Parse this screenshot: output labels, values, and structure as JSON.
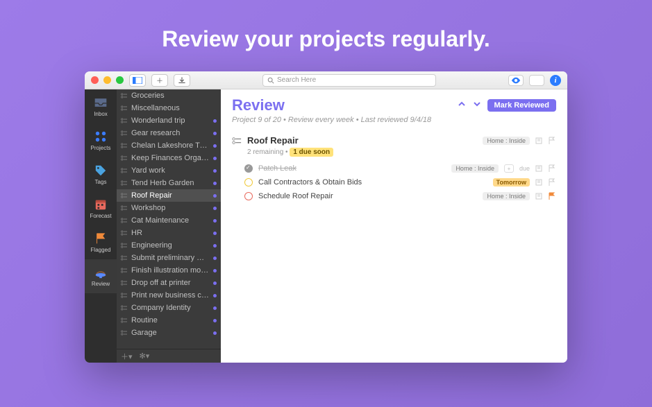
{
  "headline": "Review your projects regularly.",
  "search": {
    "placeholder": "Search Here"
  },
  "rail": {
    "items": [
      {
        "id": "inbox",
        "label": "Inbox"
      },
      {
        "id": "projects",
        "label": "Projects"
      },
      {
        "id": "tags",
        "label": "Tags"
      },
      {
        "id": "forecast",
        "label": "Forecast"
      },
      {
        "id": "flagged",
        "label": "Flagged"
      },
      {
        "id": "review",
        "label": "Review"
      }
    ]
  },
  "projects": [
    {
      "name": "Groceries",
      "dot": false
    },
    {
      "name": "Miscellaneous",
      "dot": false
    },
    {
      "name": "Wonderland trip",
      "dot": true
    },
    {
      "name": "Gear research",
      "dot": true
    },
    {
      "name": "Chelan Lakeshore Trail",
      "dot": true
    },
    {
      "name": "Keep Finances Organized",
      "dot": true
    },
    {
      "name": "Yard work",
      "dot": true
    },
    {
      "name": "Tend Herb Garden",
      "dot": true
    },
    {
      "name": "Roof Repair",
      "dot": true,
      "selected": true
    },
    {
      "name": "Workshop",
      "dot": true
    },
    {
      "name": "Cat Maintenance",
      "dot": true
    },
    {
      "name": "HR",
      "dot": true
    },
    {
      "name": "Engineering",
      "dot": true
    },
    {
      "name": "Submit preliminary marketin…",
      "dot": true
    },
    {
      "name": "Finish illustration mockups",
      "dot": true
    },
    {
      "name": "Drop off at printer",
      "dot": true
    },
    {
      "name": "Print new business cards",
      "dot": true
    },
    {
      "name": "Company Identity",
      "dot": true
    },
    {
      "name": "Routine",
      "dot": true
    },
    {
      "name": "Garage",
      "dot": true
    }
  ],
  "review": {
    "title": "Review",
    "status": "Project 9 of 20 • Review every week • Last reviewed 9/4/18",
    "mark_label": "Mark Reviewed",
    "project": {
      "title": "Roof Repair",
      "tag": "Home : Inside",
      "remaining": "2 remaining",
      "due_warn": "1 due soon"
    },
    "tasks": [
      {
        "text": "Patch Leak",
        "status": "done",
        "tag": "Home : Inside",
        "due": "due",
        "plus": true
      },
      {
        "text": "Call Contractors & Obtain Bids",
        "status": "yel",
        "badge": "Tomorrow"
      },
      {
        "text": "Schedule Roof Repair",
        "status": "red",
        "tag": "Home : Inside",
        "flag": true
      }
    ]
  }
}
